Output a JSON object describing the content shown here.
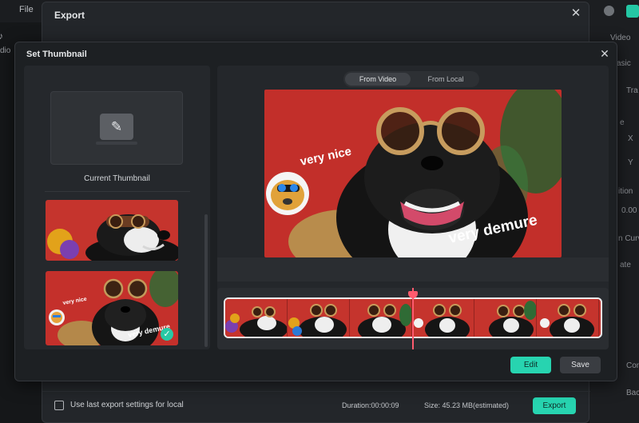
{
  "background": {
    "menu_file": "File",
    "left_label": "dio",
    "right_labels": [
      "Video",
      "asic",
      "Tra",
      "e",
      "X",
      "Y",
      "ition",
      "0.00",
      "n Curv",
      "ate",
      "Con",
      "Bac"
    ]
  },
  "export_dialog": {
    "title": "Export",
    "footer": {
      "checkbox_label": "Use last export settings for local",
      "duration": "Duration:00:00:09",
      "size": "Size: 45.23 MB(estimated)",
      "export_button": "Export"
    }
  },
  "set_thumbnail": {
    "title": "Set Thumbnail",
    "current_label": "Current Thumbnail",
    "tabs": [
      "From Video",
      "From Local"
    ],
    "active_tab": "From Video",
    "overlays": {
      "text_a": "very nice",
      "text_b": "very demure"
    },
    "edit_button": "Edit",
    "save_button": "Save",
    "colors": {
      "accent": "#27d4b0",
      "playhead": "#ff5b6e",
      "video_bg": "#c4302b"
    }
  }
}
